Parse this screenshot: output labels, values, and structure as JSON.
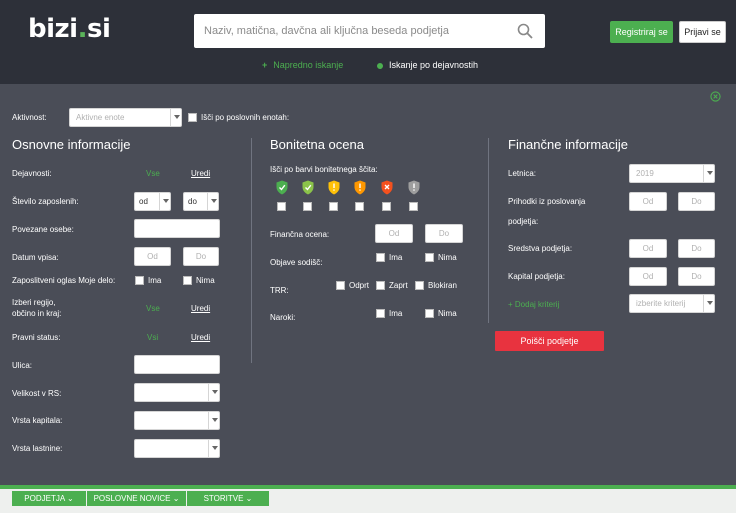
{
  "header": {
    "logo_main": "bizi",
    "logo_dot": ".",
    "logo_tld": "si",
    "search_placeholder": "Naziv, matična, davčna ali ključna beseda podjetja",
    "register": "Registriraj se",
    "login": "Prijavi se",
    "advanced_search": "Napredno iskanje",
    "activity_search": "Iskanje po dejavnostih"
  },
  "filters": {
    "activity_label": "Aktivnost:",
    "activity_select": "Aktivne enote",
    "business_units": "Išči po poslovnih enotah:"
  },
  "basic": {
    "title": "Osnovne informacije",
    "activities": "Dejavnosti:",
    "all": "Vse",
    "edit": "Uredi",
    "employees": "Število zaposlenih:",
    "from": "od",
    "to": "do",
    "related_persons": "Povezane osebe:",
    "entry_date": "Datum vpisa:",
    "od": "Od",
    "do": "Do",
    "job_ad": "Zaposlitveni oglas Moje delo:",
    "has": "Ima",
    "has_not": "Nima",
    "region": "Izberi regijo,",
    "region2": "občino in kraj:",
    "legal_status": "Pravni status:",
    "all2": "Vsi",
    "street": "Ulica:",
    "size": "Velikost v RS:",
    "capital_type": "Vrsta kapitala:",
    "ownership_type": "Vrsta lastnine:"
  },
  "rating": {
    "title": "Bonitetna ocena",
    "shield_search": "Išči po barvi bonitetnega ščita:",
    "shields": [
      "#4caf50",
      "#8bc34a",
      "#ffc107",
      "#ff9800",
      "#f4511e",
      "#9e9e9e"
    ],
    "shield_icons": [
      "check-icon",
      "check-icon",
      "exclamation-icon",
      "exclamation-icon",
      "x-icon",
      "exclamation-icon"
    ],
    "financial_rating": "Finančna ocena:",
    "court_notices": "Objave sodišč:",
    "trr": "TRR:",
    "open": "Odprt",
    "closed": "Zaprt",
    "blocked": "Blokiran",
    "claims": "Naroki:"
  },
  "finance": {
    "title": "Finančne informacije",
    "year": "Letnica:",
    "year_value": "2019",
    "revenue": "Prihodki iz poslovanja",
    "revenue2": "podjetja:",
    "assets": "Sredstva podjetja:",
    "capital": "Kapital podjetja:",
    "add_criterion": "+ Dodaj kriterij",
    "criterion_placeholder": "izberite kriterij",
    "search_button": "Poišči podjetje"
  },
  "bottom_nav": [
    "PODJETJA",
    "POSLOVNE NOVICE",
    "STORITVE"
  ]
}
